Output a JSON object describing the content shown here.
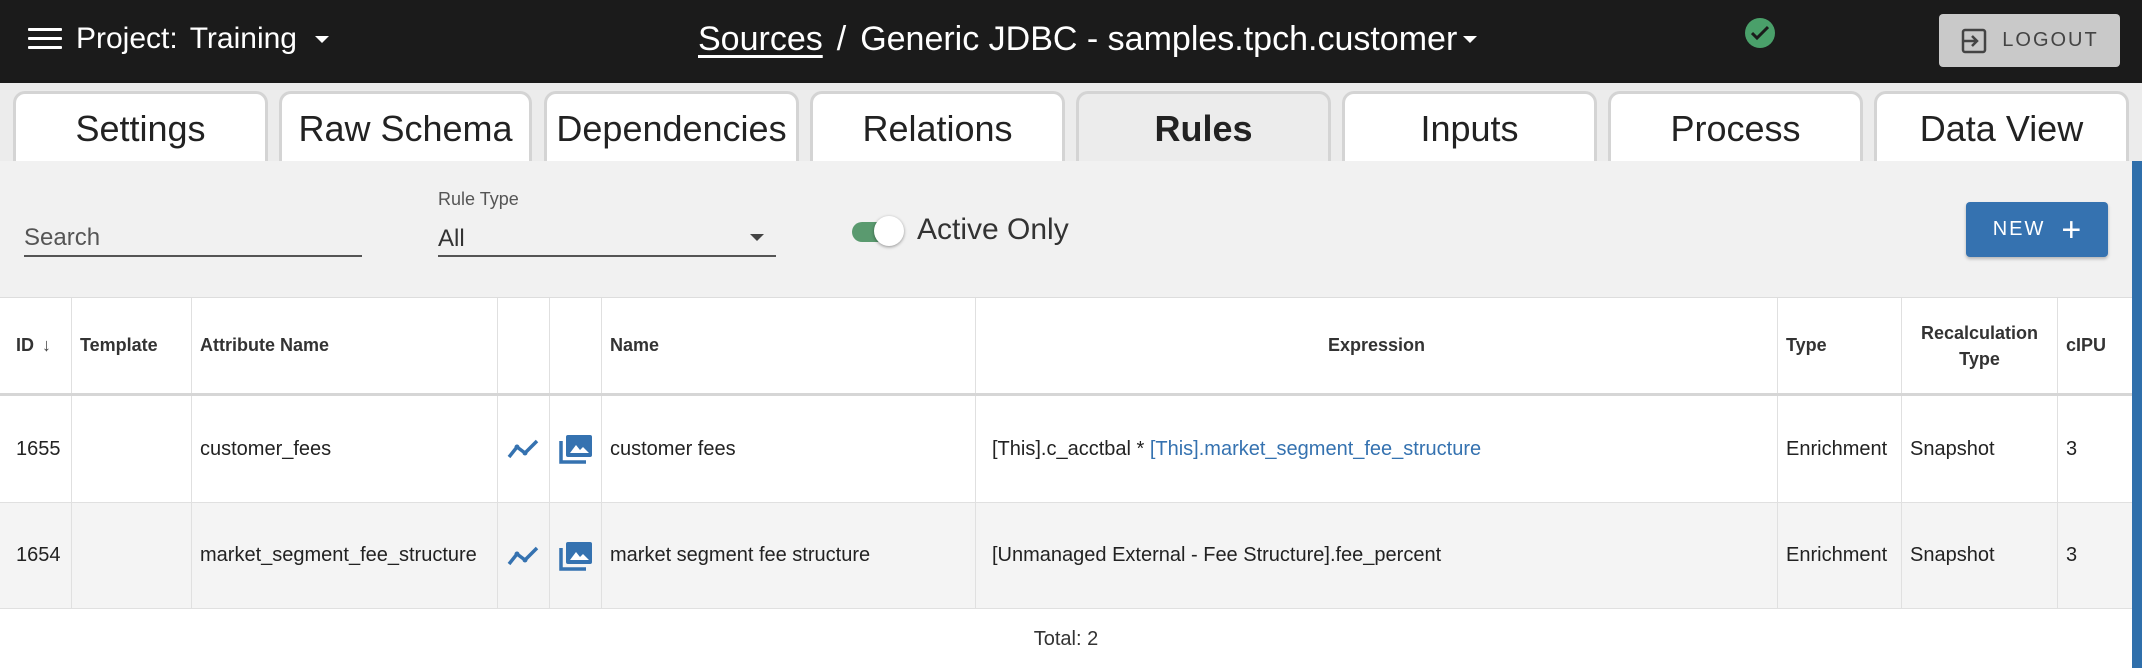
{
  "header": {
    "project_label": "Project:",
    "project_value": "Training",
    "breadcrumb_link": "Sources",
    "breadcrumb_sep": "/",
    "breadcrumb_current": "Generic JDBC - samples.tpch.customer",
    "status_icon": "check-circle-icon",
    "logout_label": "LOGOUT"
  },
  "tabs": [
    {
      "label": "Settings"
    },
    {
      "label": "Raw Schema"
    },
    {
      "label": "Dependencies"
    },
    {
      "label": "Relations"
    },
    {
      "label": "Rules",
      "active": true
    },
    {
      "label": "Inputs"
    },
    {
      "label": "Process"
    },
    {
      "label": "Data View"
    }
  ],
  "filters": {
    "search_placeholder": "Search",
    "rule_type_label": "Rule Type",
    "rule_type_value": "All",
    "active_only_label": "Active Only",
    "active_only_on": true,
    "new_label": "NEW",
    "new_icon": "+"
  },
  "table": {
    "columns": {
      "id": "ID",
      "sort_icon": "↓",
      "template": "Template",
      "attribute_name": "Attribute Name",
      "name": "Name",
      "expression": "Expression",
      "type": "Type",
      "recalculation_type": "Recalculation Type",
      "cpu": "cIPU"
    },
    "rows": [
      {
        "id": "1655",
        "template": "",
        "attribute_name": "customer_fees",
        "name": "customer fees",
        "expression_prefix": "[This].c_acctbal * ",
        "expression_link": "[This].market_segment_fee_structure",
        "type": "Enrichment",
        "recalculation_type": "Snapshot",
        "cpu": "3"
      },
      {
        "id": "1654",
        "template": "",
        "attribute_name": "market_segment_fee_structure",
        "name": "market segment fee structure",
        "expression_prefix": "[Unmanaged External - Fee Structure].fee_percent",
        "expression_link": "",
        "type": "Enrichment",
        "recalculation_type": "Snapshot",
        "cpu": "3"
      }
    ],
    "total_label": "Total: 2"
  },
  "colors": {
    "topbar": "#1b1b1b",
    "accent": "#3572b0",
    "toggle": "#5a9a6f",
    "status_ok": "#4aa06a"
  }
}
